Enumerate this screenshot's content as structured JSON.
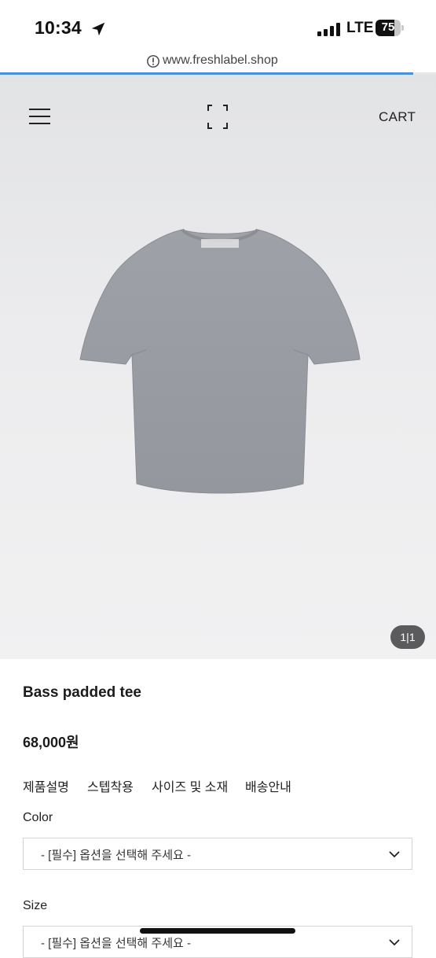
{
  "status_bar": {
    "time": "10:34",
    "network": "LTE",
    "battery": "75",
    "battery_level": 0.75,
    "icons": [
      "location-arrow-icon",
      "signal-icon",
      "battery-icon"
    ]
  },
  "browser": {
    "url": "www.freshlabel.shop",
    "icon": "info-icon"
  },
  "header": {
    "menu_icon": "hamburger-menu-icon",
    "logo_icon": "bracket-logo-icon",
    "cart_label": "CART"
  },
  "gallery": {
    "image_icon": "t-shirt-image",
    "counter": "1|1"
  },
  "product": {
    "name": "Bass padded tee",
    "price": "68,000원"
  },
  "tabs": [
    "제품설명",
    "스텝착용",
    "사이즈 및 소재",
    "배송안내"
  ],
  "options": {
    "color_label": "Color",
    "color_select": "- [필수] 옵션을 선택해 주세요 -",
    "size_label": "Size",
    "size_select": "- [필수] 옵션을 선택해 주세요 -"
  },
  "colors": {
    "accent": "#4a90d9",
    "hero_background": "#e9e9eb",
    "counter_badge": "#5b5b5d"
  }
}
